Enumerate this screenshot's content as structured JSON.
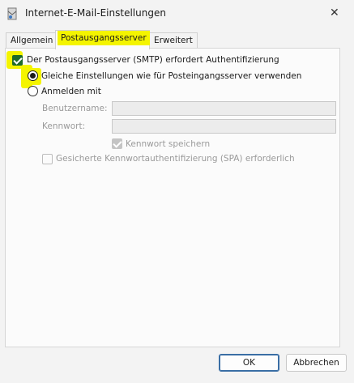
{
  "window": {
    "title": "Internet-E-Mail-Einstellungen",
    "close_symbol": "✕"
  },
  "tabs": [
    {
      "label": "Allgemein",
      "active": false
    },
    {
      "label": "Postausgangsserver",
      "active": true
    },
    {
      "label": "Erweitert",
      "active": false
    }
  ],
  "outgoing": {
    "smtp_auth_label": "Der Postausgangsserver (SMTP) erfordert Authentifizierung",
    "smtp_auth_checked": true,
    "same_settings_label": "Gleiche Einstellungen wie für Posteingangsserver verwenden",
    "same_settings_selected": true,
    "login_with_label": "Anmelden mit",
    "login_with_selected": false,
    "username_label": "Benutzername:",
    "username_value": "",
    "password_label": "Kennwort:",
    "password_value": "",
    "save_password_label": "Kennwort speichern",
    "save_password_checked": true,
    "spa_label": "Gesicherte Kennwortauthentifizierung (SPA) erforderlich",
    "spa_checked": false
  },
  "buttons": {
    "ok": "OK",
    "cancel": "Abbrechen"
  },
  "colors": {
    "highlight": "#f4f400",
    "checkbox_checked": "#1f6b2a",
    "default_button_border": "#3a6ea5"
  },
  "icons": {
    "app": "outlook-envelope-icon",
    "close": "close-icon"
  }
}
